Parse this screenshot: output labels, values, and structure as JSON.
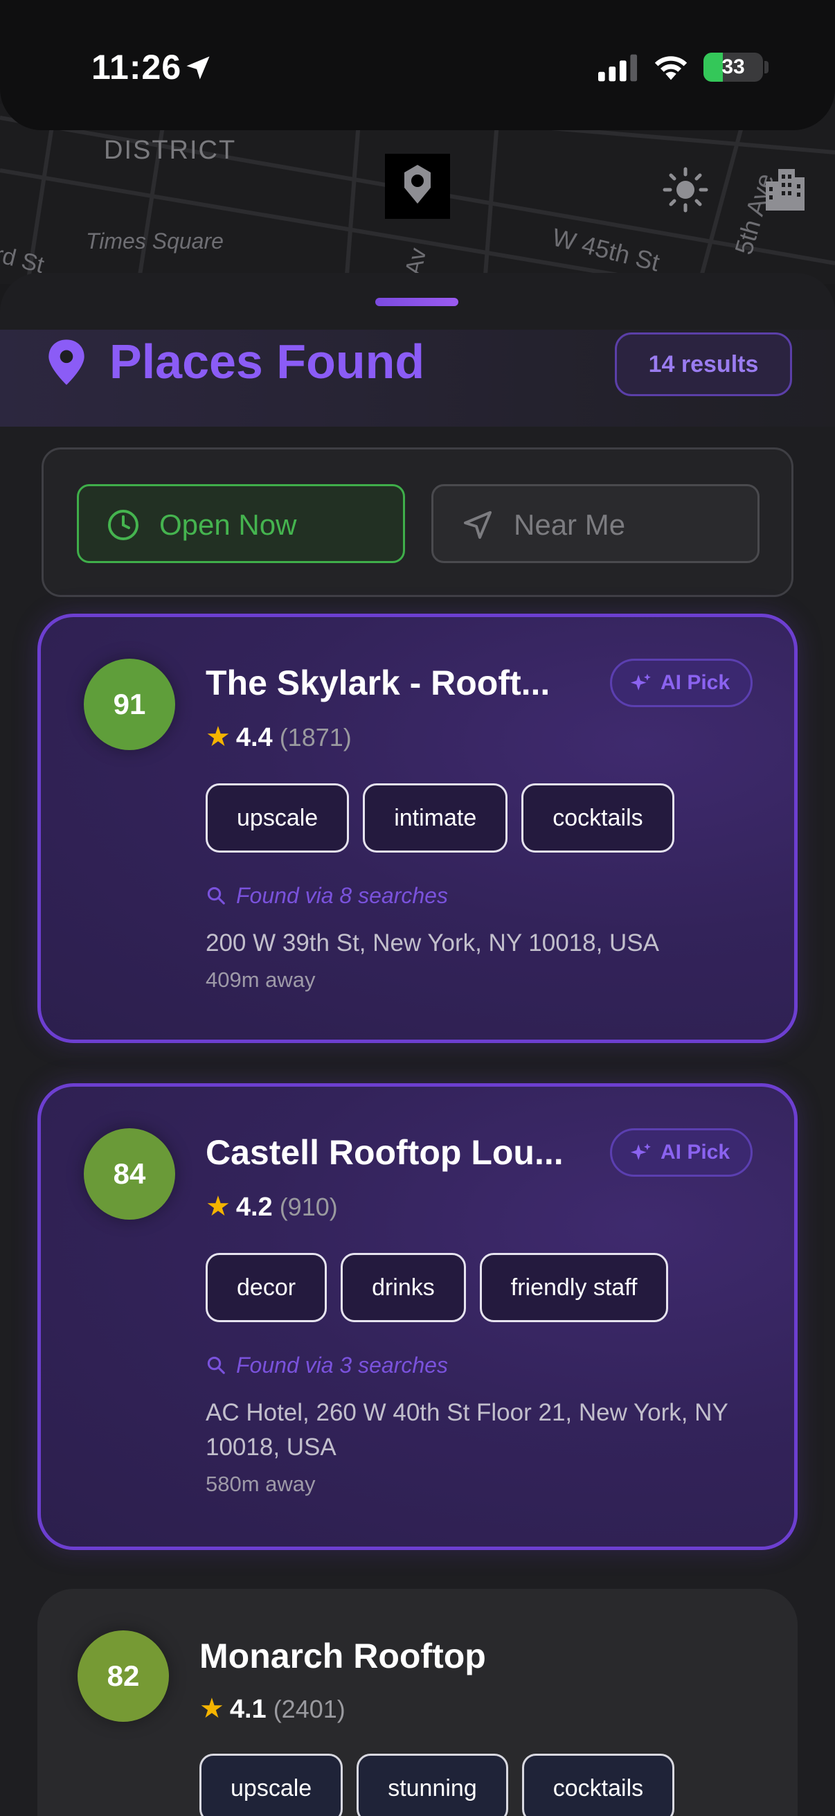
{
  "status_bar": {
    "time": "11:26",
    "battery": "33",
    "battery_level": 0.33,
    "battery_color": "#34c759"
  },
  "map": {
    "labels": {
      "district": "DISTRICT",
      "times_square": "Times Square",
      "w45": "W 45th St",
      "rdst": "rd St",
      "ave6": "th Av",
      "ave5": "5th Ave"
    },
    "icons": [
      "location-pin-icon",
      "sun-icon",
      "building-icon"
    ]
  },
  "header": {
    "title": "Places Found",
    "results": "14 results",
    "accent": "#8b5cf6"
  },
  "filters": [
    {
      "label": "Open Now",
      "icon": "clock-icon",
      "active": true,
      "color": "#3fae4a"
    },
    {
      "label": "Near Me",
      "icon": "navigation-arrow-icon",
      "active": false
    }
  ],
  "places": [
    {
      "score": "91",
      "score_color": "#5f9e3a",
      "name": "The Skylark - Rooft...",
      "ai_pick": "AI Pick",
      "rating": "4.4",
      "reviews": "(1871)",
      "tags": [
        "upscale",
        "intimate",
        "cocktails"
      ],
      "found_via": "Found via 8 searches",
      "address": "200 W 39th St, New York, NY 10018, USA",
      "distance": "409m away"
    },
    {
      "score": "84",
      "score_color": "#6a9a38",
      "name": "Castell Rooftop Lou...",
      "ai_pick": "AI Pick",
      "rating": "4.2",
      "reviews": "(910)",
      "tags": [
        "decor",
        "drinks",
        "friendly staff"
      ],
      "found_via": "Found via 3 searches",
      "address": "AC Hotel, 260 W 40th St Floor 21, New York, NY 10018, USA",
      "distance": "580m away"
    },
    {
      "score": "82",
      "score_color": "#769a34",
      "name": "Monarch Rooftop",
      "rating": "4.1",
      "reviews": "(2401)",
      "tags": [
        "upscale",
        "stunning",
        "cocktails"
      ]
    }
  ]
}
